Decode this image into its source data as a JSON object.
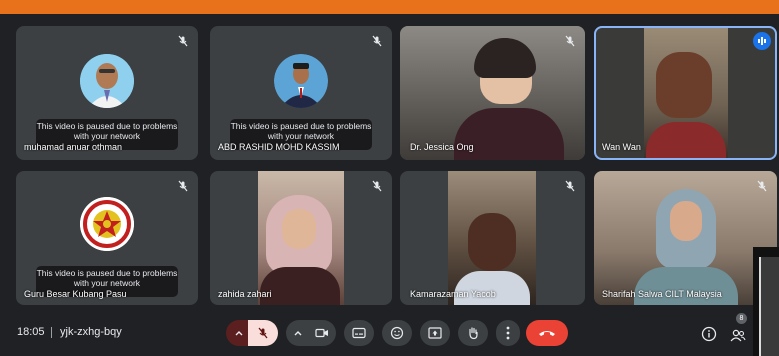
{
  "meeting": {
    "time": "18:05",
    "code": "yjk-zxhg-bqy"
  },
  "paused_notice": {
    "line1": "This video is paused due to problems",
    "line2": "with your network"
  },
  "participants": [
    {
      "name": "muhamad anuar othman",
      "paused": true,
      "muted": true
    },
    {
      "name": "ABD RASHID MOHD KASSIM",
      "paused": true,
      "muted": true
    },
    {
      "name": "Dr. Jessica Ong",
      "paused": false,
      "muted": true
    },
    {
      "name": "Wan Wan",
      "paused": false,
      "muted": false,
      "speaking": true
    },
    {
      "name": "Guru Besar Kubang Pasu",
      "paused": true,
      "muted": true
    },
    {
      "name": "zahida zahari",
      "paused": false,
      "muted": true
    },
    {
      "name": "Kamarazaman Yacob",
      "paused": false,
      "muted": true
    },
    {
      "name": "Sharifah Salwa CILT Malaysia",
      "paused": false,
      "muted": true
    }
  ],
  "people_count": "8",
  "colors": {
    "end_call": "#ea4335",
    "mic_off": "#f9dedc",
    "accent": "#8ab4f8",
    "brand_bar": "#e8711c"
  },
  "icons": [
    "chevron-up-icon",
    "mic-off-icon",
    "camera-icon",
    "captions-icon",
    "emoji-icon",
    "present-icon",
    "raise-hand-icon",
    "more-icon",
    "end-call-icon",
    "info-icon",
    "people-icon"
  ]
}
